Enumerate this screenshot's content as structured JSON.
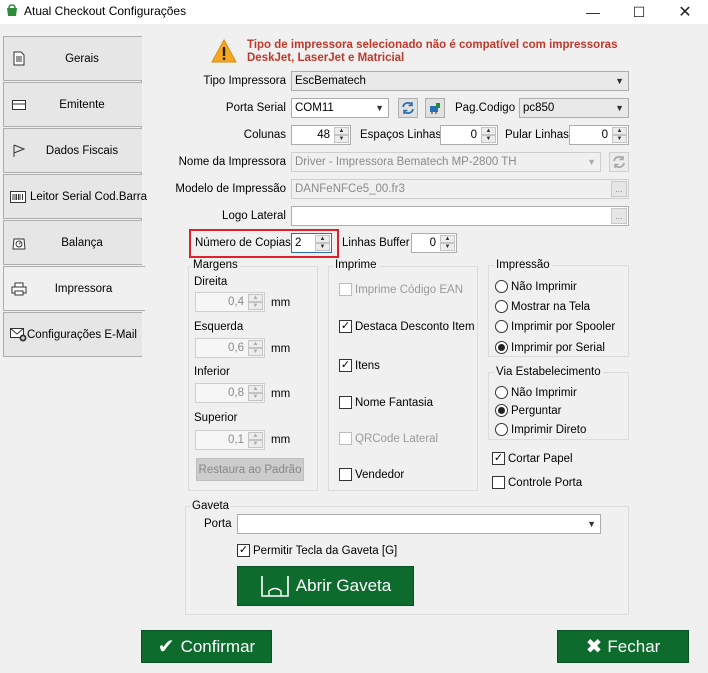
{
  "window": {
    "title": "Atual Checkout Configurações",
    "minimize_icon": "minimize-icon",
    "maximize_icon": "maximize-icon",
    "close_icon": "close-icon"
  },
  "sidebar": {
    "items": [
      {
        "label": "Gerais",
        "icon": "document-icon"
      },
      {
        "label": "Emitente",
        "icon": "card-icon"
      },
      {
        "label": "Dados Fiscais",
        "icon": "flag-icon"
      },
      {
        "label": "Leitor Serial Cod.Barra",
        "icon": "barcode-icon"
      },
      {
        "label": "Balança",
        "icon": "scale-icon"
      },
      {
        "label": "Impressora",
        "icon": "printer-icon"
      },
      {
        "label": "Configurações E-Mail",
        "icon": "email-add-icon"
      }
    ],
    "active": "Impressora"
  },
  "warning": {
    "text_line1": "Tipo de impressora selecionado não é compatível com impressoras",
    "text_line2": "DeskJet, LaserJet e Matricial",
    "color": "#c0392b"
  },
  "form": {
    "tipo_impressora_label": "Tipo Impressora",
    "tipo_impressora_value": "EscBematech",
    "porta_serial_label": "Porta Serial",
    "porta_serial_value": "COM11",
    "pag_codigo_label": "Pag.Codigo",
    "pag_codigo_value": "pc850",
    "colunas_label": "Colunas",
    "colunas_value": "48",
    "espacos_linhas_label": "Espaços Linhas",
    "espacos_linhas_value": "0",
    "pular_linhas_label": "Pular Linhas",
    "pular_linhas_value": "0",
    "nome_impressora_label": "Nome da Impressora",
    "nome_impressora_value": "Driver - Impressora Bematech MP-2800 TH",
    "modelo_impressao_label": "Modelo de Impressão",
    "modelo_impressao_value": "DANFeNFCe5_00.fr3",
    "logo_lateral_label": "Logo Lateral",
    "logo_lateral_value": "",
    "numero_copias_label": "Número de Copias",
    "numero_copias_value": "2",
    "linhas_buffer_label": "Linhas Buffer",
    "linhas_buffer_value": "0",
    "highlight_color": "#e0202a"
  },
  "margens": {
    "title": "Margens",
    "direita_label": "Direita",
    "direita_value": "0,4",
    "esquerda_label": "Esquerda",
    "esquerda_value": "0,6",
    "inferior_label": "Inferior",
    "inferior_value": "0,8",
    "superior_label": "Superior",
    "superior_value": "0,1",
    "unit": "mm",
    "restore_label": "Restaura ao Padrão"
  },
  "imprime": {
    "title": "Imprime",
    "items": [
      {
        "label": "Imprime Código EAN",
        "checked": false,
        "disabled": true
      },
      {
        "label": "Destaca Desconto Item",
        "checked": true,
        "disabled": false
      },
      {
        "label": "Itens",
        "checked": true,
        "disabled": false
      },
      {
        "label": "Nome Fantasia",
        "checked": false,
        "disabled": false
      },
      {
        "label": "QRCode Lateral",
        "checked": false,
        "disabled": true
      },
      {
        "label": "Vendedor",
        "checked": false,
        "disabled": false
      }
    ]
  },
  "impressao": {
    "title": "Impressão",
    "options": [
      {
        "label": "Não Imprimir",
        "selected": false
      },
      {
        "label": "Mostrar na Tela",
        "selected": false
      },
      {
        "label": "Imprimir por Spooler",
        "selected": false
      },
      {
        "label": "Imprimir por Serial",
        "selected": true
      }
    ]
  },
  "via_estabelecimento": {
    "title": "Via Estabelecimento",
    "options": [
      {
        "label": "Não Imprimir",
        "selected": false
      },
      {
        "label": "Perguntar",
        "selected": true
      },
      {
        "label": "Imprimir Direto",
        "selected": false
      }
    ]
  },
  "extras": {
    "cortar_papel_label": "Cortar Papel",
    "cortar_papel_checked": true,
    "controle_porta_label": "Controle Porta",
    "controle_porta_checked": false
  },
  "gaveta": {
    "title": "Gaveta",
    "porta_label": "Porta",
    "porta_value": "",
    "permitir_label": "Permitir Tecla da Gaveta [G]",
    "permitir_checked": true,
    "abrir_label": "Abrir Gaveta"
  },
  "footer": {
    "confirmar_label": "Confirmar",
    "fechar_label": "Fechar",
    "button_color": "#0e6b2e"
  }
}
